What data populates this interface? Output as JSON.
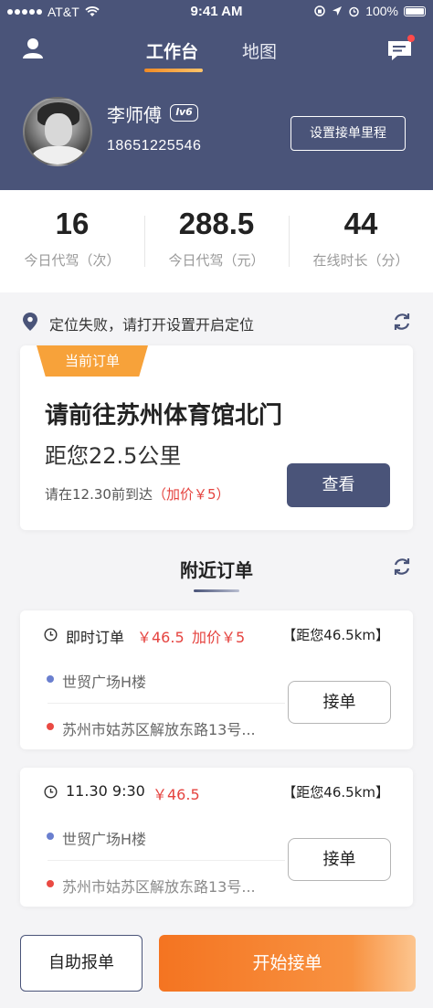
{
  "status_bar": {
    "carrier": "AT&T",
    "time": "9:41 AM",
    "battery": "100%"
  },
  "nav": {
    "tabs": [
      {
        "label": "工作台",
        "active": true
      },
      {
        "label": "地图",
        "active": false
      }
    ],
    "left_icon": "user-icon",
    "right_icon": "message-icon",
    "has_unread": true
  },
  "profile": {
    "name": "李师傅",
    "level": "lv6",
    "phone": "18651225546",
    "route_button": "设置接单里程"
  },
  "stats": [
    {
      "value": "16",
      "label": "今日代驾（次）"
    },
    {
      "value": "288.5",
      "label": "今日代驾（元）"
    },
    {
      "value": "44",
      "label": "在线时长（分）"
    }
  ],
  "location": {
    "message": "定位失败，请打开设置开启定位"
  },
  "current_order": {
    "tag": "当前订单",
    "title": "请前往苏州体育馆北门",
    "distance": "距您22.5公里",
    "arrive_prefix": "请在12.30前到达",
    "arrive_extra": "（加价￥5）",
    "view_button": "查看"
  },
  "nearby": {
    "title": "附近订单",
    "orders": [
      {
        "type": "即时订单",
        "price": "￥46.5",
        "extra": "加价￥5",
        "distance": "【距您46.5km】",
        "from": "世贸广场H楼",
        "to": "苏州市姑苏区解放东路13号...",
        "button": "接单"
      },
      {
        "type": "11.30 9:30",
        "price": "￥46.5",
        "extra": "",
        "distance": "【距您46.5km】",
        "from": "世贸广场H楼",
        "to": "苏州市姑苏区解放东路13号...",
        "button": "接单"
      }
    ]
  },
  "bottom": {
    "self_report": "自助报单",
    "start": "开始接单"
  },
  "colors": {
    "header": "#4a5479",
    "accent_orange": "#f47421",
    "price_red": "#e5433f"
  }
}
